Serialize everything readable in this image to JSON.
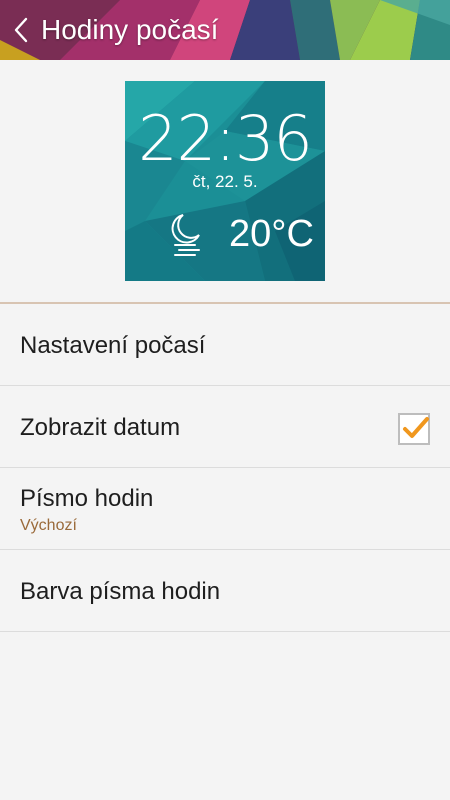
{
  "header": {
    "title": "Hodiny počasí",
    "back_icon": "chevron-left-icon"
  },
  "widget": {
    "time": "22:36",
    "date": "čt, 22. 5.",
    "temperature": "20°C",
    "weather_icon": "moon-fog-icon",
    "background_color": "#1a8a93"
  },
  "settings": {
    "items": [
      {
        "label": "Nastavení počasí"
      },
      {
        "label": "Zobrazit datum",
        "checked": true
      },
      {
        "label": "Písmo hodin",
        "summary": "Výchozí"
      },
      {
        "label": "Barva písma hodin"
      }
    ]
  },
  "colors": {
    "accent": "#f0971e",
    "summary_text": "#9a6a3a",
    "divider_accent": "#d8c4b2"
  }
}
